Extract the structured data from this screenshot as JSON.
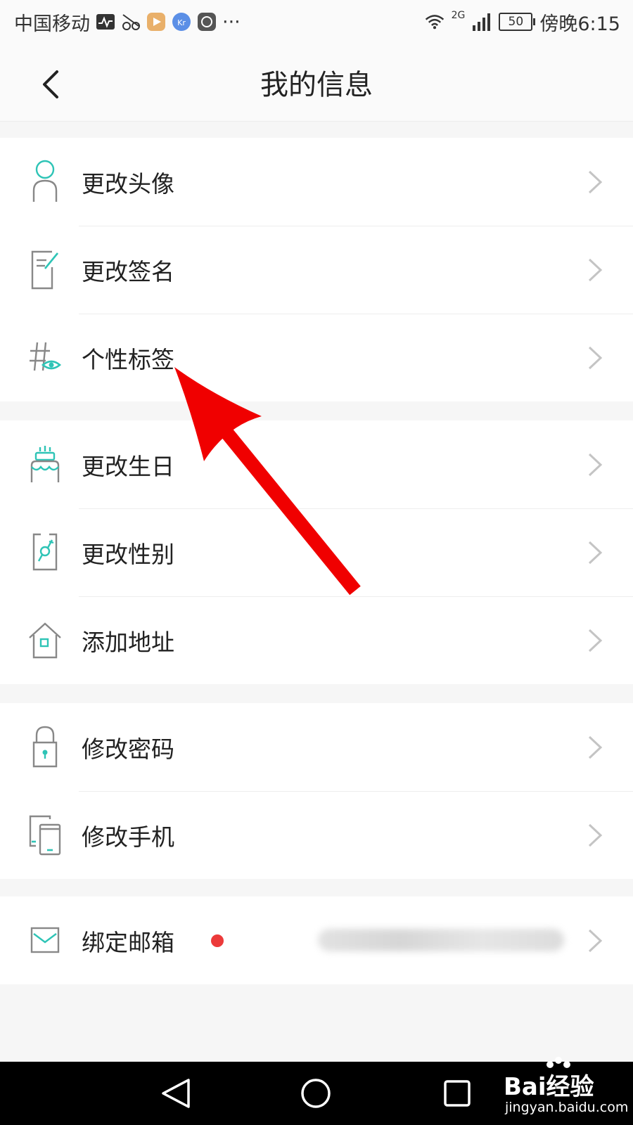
{
  "status_bar": {
    "carrier": "中国移动",
    "network": "2G",
    "battery": "50",
    "time": "傍晚6:15",
    "more": "···"
  },
  "header": {
    "title": "我的信息"
  },
  "groups": [
    {
      "items": [
        {
          "label": "更改头像",
          "icon": "avatar-icon"
        },
        {
          "label": "更改签名",
          "icon": "signature-icon"
        },
        {
          "label": "个性标签",
          "icon": "tag-icon"
        }
      ]
    },
    {
      "items": [
        {
          "label": "更改生日",
          "icon": "birthday-cake-icon"
        },
        {
          "label": "更改性别",
          "icon": "gender-icon"
        },
        {
          "label": "添加地址",
          "icon": "house-icon"
        }
      ]
    },
    {
      "items": [
        {
          "label": "修改密码",
          "icon": "lock-icon"
        },
        {
          "label": "修改手机",
          "icon": "phone-icon"
        }
      ]
    },
    {
      "items": [
        {
          "label": "绑定邮箱",
          "icon": "mail-icon"
        }
      ]
    }
  ],
  "watermark": {
    "brand": "Bai经验",
    "site": "jingyan.baidu.com"
  },
  "colors": {
    "accent": "#2ec4b6",
    "icon_gray": "#888888",
    "dot": "#ec3a3a",
    "arrow": "#f00000"
  }
}
